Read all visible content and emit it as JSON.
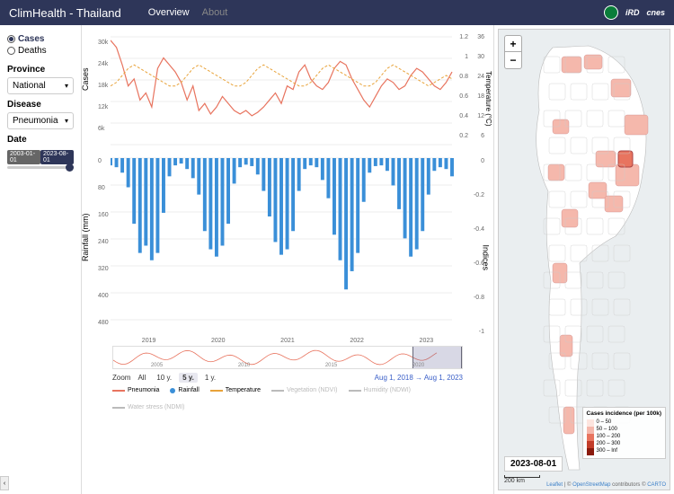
{
  "header": {
    "title": "ClimHealth - Thailand",
    "nav": {
      "overview": "Overview",
      "about": "About"
    },
    "logos": {
      "ird": "iRD",
      "cnes": "cnes"
    }
  },
  "sidebar": {
    "metric": {
      "cases": "Cases",
      "deaths": "Deaths",
      "selected": "cases"
    },
    "province": {
      "label": "Province",
      "value": "National"
    },
    "disease": {
      "label": "Disease",
      "value": "Pneumonia"
    },
    "date": {
      "label": "Date",
      "start": "2003-01-01",
      "end": "2023-08-01"
    }
  },
  "chart_data": [
    {
      "type": "line",
      "panel": "upper",
      "ylabel": "Cases",
      "ylabel_right1": "Temperature (°C)",
      "ylim": [
        0,
        32000
      ],
      "y_ticks": [
        "6k",
        "12k",
        "18k",
        "24k",
        "30k"
      ],
      "y2_ticks": [
        "0.2",
        "0.4",
        "0.6",
        "0.8",
        "1",
        "1.2"
      ],
      "y3_ticks": [
        "6",
        "12",
        "18",
        "24",
        "30",
        "36"
      ],
      "x": [
        "2019",
        "2020",
        "2021",
        "2022",
        "2023"
      ],
      "series": [
        {
          "name": "Pneumonia",
          "color": "#e8745f",
          "style": "solid",
          "values": [
            31000,
            29000,
            24000,
            18000,
            20000,
            14000,
            16000,
            12000,
            23000,
            26000,
            24000,
            22000,
            19000,
            14000,
            18000,
            11000,
            13000,
            10000,
            12000,
            15000,
            13000,
            11000,
            10000,
            11000,
            9500,
            10500,
            12000,
            14000,
            16000,
            13000,
            18000,
            17000,
            22000,
            24000,
            20000,
            18000,
            17000,
            19000,
            23000,
            25000,
            24000,
            20000,
            17000,
            14000,
            12000,
            15000,
            18000,
            20000,
            19000,
            17000,
            18000,
            21000,
            23000,
            22000,
            20000,
            18000,
            17000,
            19000,
            22000
          ]
        },
        {
          "name": "Temperature",
          "color": "#e8a33a",
          "style": "dashed",
          "values": [
            22,
            23,
            25,
            27,
            28,
            27,
            26,
            25,
            24,
            23,
            22,
            22,
            23,
            25,
            27,
            28,
            27,
            26,
            25,
            24,
            23,
            22,
            22,
            23,
            25,
            27,
            28,
            27,
            26,
            25,
            24,
            23,
            22,
            22,
            23,
            25,
            27,
            28,
            27,
            26,
            25,
            24,
            23,
            22,
            22,
            23,
            25,
            27,
            28,
            27,
            26,
            25,
            24,
            23,
            22,
            23,
            24,
            25,
            24
          ]
        }
      ]
    },
    {
      "type": "bar",
      "panel": "lower",
      "ylabel": "Rainfall (mm)",
      "ylabel_right": "Indices",
      "ylim": [
        0,
        480
      ],
      "y_ticks": [
        "0",
        "80",
        "160",
        "240",
        "320",
        "400",
        "480"
      ],
      "y_right_ticks": [
        "0",
        "-0.2",
        "-0.4",
        "-0.6",
        "-0.8",
        "-1"
      ],
      "x": [
        "2019",
        "2020",
        "2021",
        "2022",
        "2023"
      ],
      "series": [
        {
          "name": "Rainfall",
          "color": "#3a8fd8",
          "values": [
            20,
            25,
            40,
            80,
            180,
            260,
            240,
            280,
            260,
            150,
            50,
            20,
            15,
            30,
            55,
            100,
            200,
            250,
            270,
            240,
            180,
            70,
            25,
            18,
            22,
            45,
            90,
            160,
            230,
            265,
            250,
            200,
            90,
            30,
            20,
            25,
            60,
            110,
            210,
            280,
            360,
            310,
            260,
            120,
            40,
            22,
            20,
            35,
            75,
            140,
            220,
            270,
            250,
            200,
            100,
            35,
            25,
            30,
            50
          ]
        }
      ]
    }
  ],
  "navigator": {
    "x_ticks": [
      "2005",
      "2010",
      "2015",
      "2020"
    ]
  },
  "zoom": {
    "label": "Zoom",
    "buttons": [
      "All",
      "10 y.",
      "5 y.",
      "1 y."
    ],
    "active": "5 y.",
    "from": "Aug 1, 2018",
    "to": "Aug 1, 2023",
    "arrow": "→"
  },
  "legend": {
    "items": [
      {
        "name": "Pneumonia",
        "color": "#e8745f",
        "type": "line"
      },
      {
        "name": "Rainfall",
        "color": "#3a8fd8",
        "type": "dot"
      },
      {
        "name": "Temperature",
        "color": "#e8a33a",
        "type": "line"
      },
      {
        "name": "Vegetation (NDVI)",
        "color": "#bbb",
        "type": "line",
        "muted": true
      },
      {
        "name": "Humidity (NDWI)",
        "color": "#bbb",
        "type": "line",
        "muted": true
      },
      {
        "name": "Water stress (NDMI)",
        "color": "#bbb",
        "type": "line",
        "muted": true
      }
    ]
  },
  "map": {
    "date_label": "2023-08-01",
    "scale": "200 km",
    "attrib": {
      "leaflet": "Leaflet",
      "osm": "OpenStreetMap",
      "mid": " contributors © ",
      "carto": "CARTO"
    },
    "legend": {
      "title": "Cases incidence (per 100k)",
      "bins": [
        {
          "label": "0 – 50",
          "color": "#fde5df"
        },
        {
          "label": "50 – 100",
          "color": "#f5b8ac"
        },
        {
          "label": "100 – 200",
          "color": "#e8745f"
        },
        {
          "label": "200 – 300",
          "color": "#c23d2a"
        },
        {
          "label": "300 – Inf",
          "color": "#8a1a0d"
        }
      ]
    }
  }
}
